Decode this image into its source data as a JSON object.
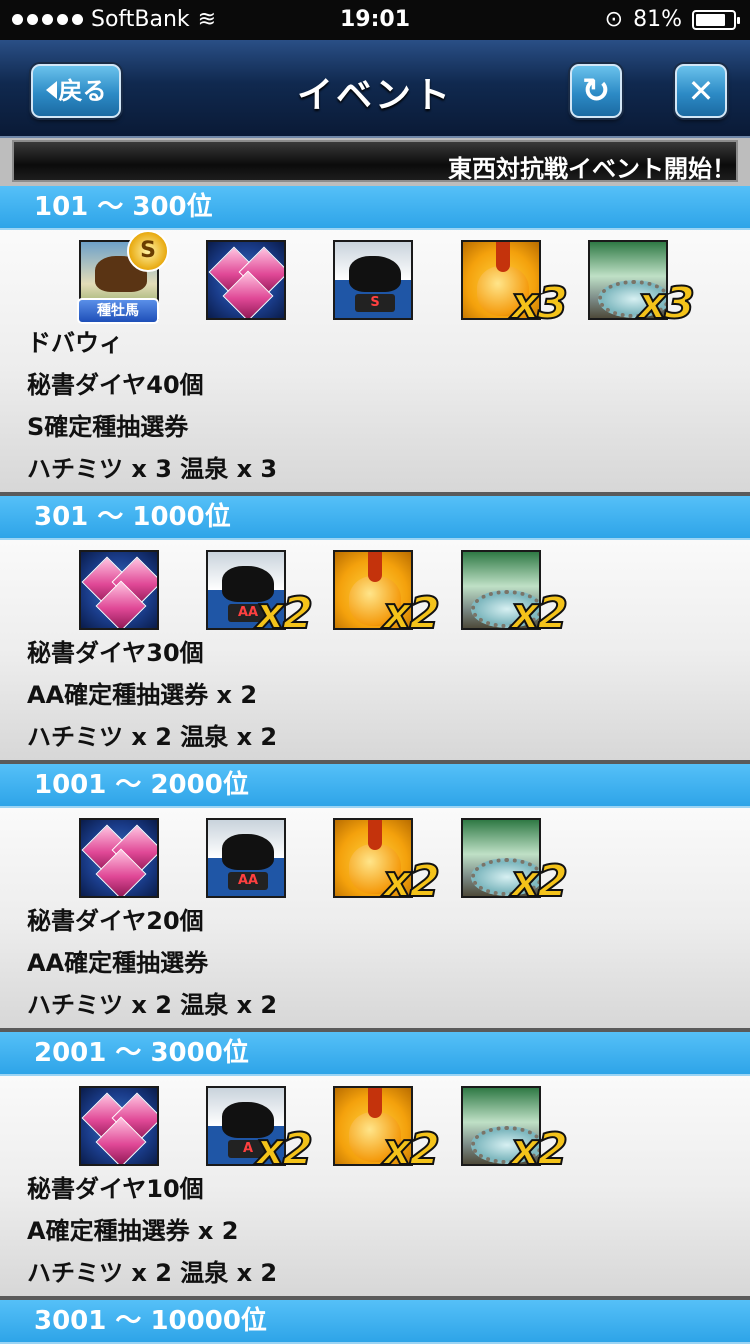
{
  "status_bar": {
    "carrier": "SoftBank",
    "time": "19:01",
    "battery": "81%",
    "battery_level": 0.81
  },
  "header": {
    "back_label": "戻る",
    "title": "イベント",
    "refresh_icon": "refresh-icon",
    "close_icon": "close-icon"
  },
  "ticker": {
    "text": "東西対抗戦イベント開始！"
  },
  "sections": [
    {
      "rank": "101 〜 300位",
      "items": [
        {
          "kind": "stallion",
          "name": "stallion-card-icon",
          "badge": "種牡馬",
          "mult": ""
        },
        {
          "kind": "diamond",
          "name": "diamond-icon",
          "mult": ""
        },
        {
          "kind": "ticket",
          "name": "s-ticket-icon",
          "grade": "S",
          "mult": ""
        },
        {
          "kind": "honey",
          "name": "honey-icon",
          "mult": "x3"
        },
        {
          "kind": "onsen",
          "name": "onsen-icon",
          "mult": "x3"
        }
      ],
      "lines": [
        "ドバウィ",
        "秘書ダイヤ40個",
        "S確定種抽選券",
        "ハチミツ x 3 温泉 x 3"
      ]
    },
    {
      "rank": "301 〜 1000位",
      "items": [
        {
          "kind": "diamond",
          "name": "diamond-icon",
          "mult": ""
        },
        {
          "kind": "ticket",
          "name": "aa-ticket-icon",
          "grade": "AA",
          "mult": "x2"
        },
        {
          "kind": "honey",
          "name": "honey-icon",
          "mult": "x2"
        },
        {
          "kind": "onsen",
          "name": "onsen-icon",
          "mult": "x2"
        }
      ],
      "lines": [
        "秘書ダイヤ30個",
        "AA確定種抽選券 x 2",
        "ハチミツ x 2 温泉 x 2"
      ]
    },
    {
      "rank": "1001 〜 2000位",
      "items": [
        {
          "kind": "diamond",
          "name": "diamond-icon",
          "mult": ""
        },
        {
          "kind": "ticket",
          "name": "aa-ticket-icon",
          "grade": "AA",
          "mult": ""
        },
        {
          "kind": "honey",
          "name": "honey-icon",
          "mult": "x2"
        },
        {
          "kind": "onsen",
          "name": "onsen-icon",
          "mult": "x2"
        }
      ],
      "lines": [
        "秘書ダイヤ20個",
        "AA確定種抽選券",
        "ハチミツ x 2 温泉 x 2"
      ]
    },
    {
      "rank": "2001 〜 3000位",
      "items": [
        {
          "kind": "diamond",
          "name": "diamond-icon",
          "mult": ""
        },
        {
          "kind": "ticket",
          "name": "a-ticket-icon",
          "grade": "A",
          "mult": "x2"
        },
        {
          "kind": "honey",
          "name": "honey-icon",
          "mult": "x2"
        },
        {
          "kind": "onsen",
          "name": "onsen-icon",
          "mult": "x2"
        }
      ],
      "lines": [
        "秘書ダイヤ10個",
        "A確定種抽選券 x 2",
        "ハチミツ x 2 温泉 x 2"
      ]
    },
    {
      "rank": "3001 〜 10000位",
      "items": [],
      "lines": []
    }
  ]
}
